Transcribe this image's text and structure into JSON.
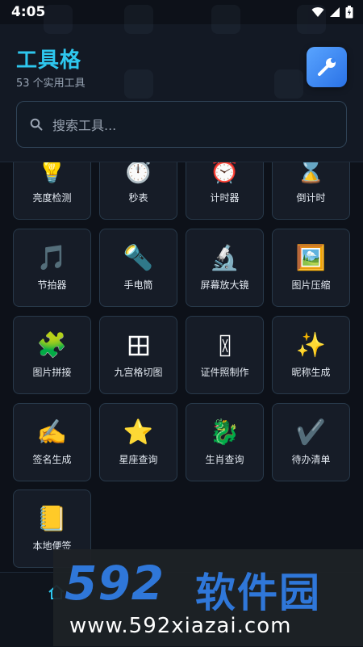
{
  "status_bar": {
    "time": "4:05"
  },
  "header": {
    "title": "工具格",
    "subtitle": "53 个实用工具",
    "settings_icon": "wrench-icon"
  },
  "search": {
    "placeholder": "搜索工具..."
  },
  "tools": [
    {
      "label": "亮度检测",
      "icon": "💡"
    },
    {
      "label": "秒表",
      "icon": "⏱️"
    },
    {
      "label": "计时器",
      "icon": "⏰"
    },
    {
      "label": "倒计时",
      "icon": "⌛"
    },
    {
      "label": "节拍器",
      "icon": "🎵"
    },
    {
      "label": "手电筒",
      "icon": "🔦"
    },
    {
      "label": "屏幕放大镜",
      "icon": "🔬"
    },
    {
      "label": "图片压缩",
      "icon": "🖼️"
    },
    {
      "label": "图片拼接",
      "icon": "🧩"
    },
    {
      "label": "九宫格切图",
      "icon": "⊞"
    },
    {
      "label": "证件照制作",
      "icon": "🪪"
    },
    {
      "label": "昵称生成",
      "icon": "✨"
    },
    {
      "label": "签名生成",
      "icon": "✍️"
    },
    {
      "label": "星座查询",
      "icon": "⭐"
    },
    {
      "label": "生肖查询",
      "icon": "🐉"
    },
    {
      "label": "待办清单",
      "icon": "✔️"
    },
    {
      "label": "本地便签",
      "icon": "📒"
    }
  ],
  "watermark": {
    "logo": "592",
    "name": "软件园",
    "url": "www.592xiazai.com"
  },
  "colors": {
    "accent": "#2ec7ee",
    "background": "#0d1119",
    "tile": "#161c27",
    "tile_border": "#28394a"
  }
}
